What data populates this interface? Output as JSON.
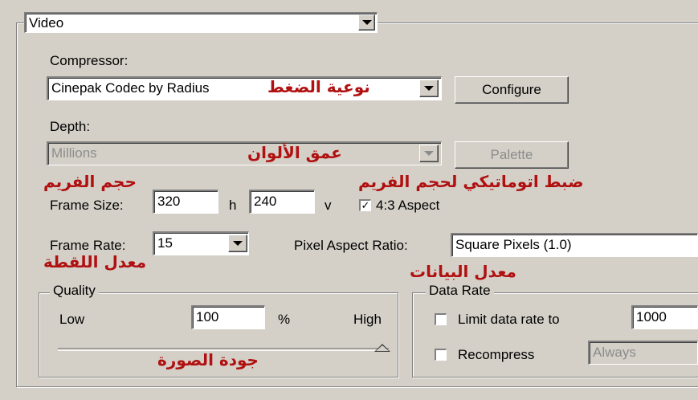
{
  "video_group": {
    "selected": "Video",
    "compressor": {
      "label": "Compressor:",
      "value": "Cinepak Codec by Radius",
      "configure_label": "Configure"
    },
    "depth": {
      "label": "Depth:",
      "value": "Millions",
      "palette_label": "Palette"
    },
    "frame_size": {
      "label": "Frame Size:",
      "width": "320",
      "h_label": "h",
      "height": "240",
      "v_label": "v",
      "aspect_label": "4:3 Aspect",
      "aspect_checked": true
    },
    "frame_rate": {
      "label": "Frame Rate:",
      "value": "15"
    },
    "pixel_aspect": {
      "label": "Pixel Aspect Ratio:",
      "value": "Square Pixels (1.0)"
    },
    "quality": {
      "title": "Quality",
      "low_label": "Low",
      "value": "100",
      "percent_label": "%",
      "high_label": "High",
      "level": 1.0
    },
    "data_rate": {
      "title": "Data Rate",
      "limit_label": "Limit data rate to",
      "limit_checked": false,
      "limit_value": "1000",
      "recompress_label": "Recompress",
      "recompress_checked": false,
      "recompress_value": "Always"
    }
  },
  "annotations": {
    "compressor_type": "نوعية الضغط",
    "color_depth": "عمق الألوان",
    "frame_size": "حجم الفريم",
    "auto_aspect": "ضبط اتوماتيكي لحجم الفريم",
    "frame_rate": "معدل اللقطة",
    "data_rate": "معدل البيانات",
    "image_quality": "جودة الصورة"
  }
}
